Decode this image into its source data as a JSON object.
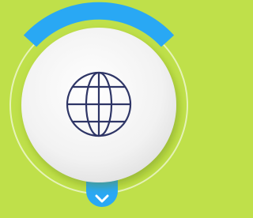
{
  "colors": {
    "background": "#bfe04a",
    "accent": "#29a8f4",
    "disc": "#f4f4f4",
    "icon": "#2e3566",
    "ring": "#e6f3b8"
  },
  "widget": {
    "icon": "globe-icon",
    "expand_icon": "chevron-down-icon"
  }
}
